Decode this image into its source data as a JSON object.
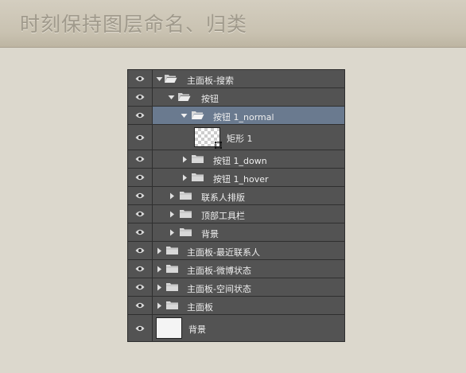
{
  "banner": {
    "title": "时刻保持图层命名、归类"
  },
  "layers": [
    {
      "label": "主面板-搜索",
      "expanded": true
    },
    {
      "label": "按钮",
      "expanded": true
    },
    {
      "label": "按钮 1_normal",
      "expanded": true,
      "selected": true
    },
    {
      "label": "矩形 1"
    },
    {
      "label": "按钮 1_down",
      "expanded": false
    },
    {
      "label": "按钮 1_hover",
      "expanded": false
    },
    {
      "label": "联系人排版",
      "expanded": false
    },
    {
      "label": "顶部工具栏",
      "expanded": false
    },
    {
      "label": "背景",
      "expanded": false
    },
    {
      "label": "主面板-最近联系人",
      "expanded": false
    },
    {
      "label": "主面板-微博状态",
      "expanded": false
    },
    {
      "label": "主面板-空间状态",
      "expanded": false
    },
    {
      "label": "主面板",
      "expanded": false
    },
    {
      "label": "背景"
    }
  ],
  "colors": {
    "panel": "#535353",
    "selected_row": "#6a7a8f",
    "text": "#eeeeee",
    "banner_text": "#a09a8c"
  }
}
